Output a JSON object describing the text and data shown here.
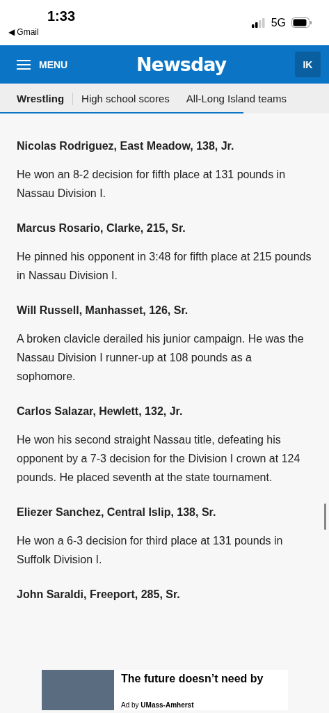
{
  "status_bar": {
    "time": "1:33",
    "back_app": "◀ Gmail",
    "network": "5G"
  },
  "header": {
    "menu_label": "MENU",
    "logo": "Newsday",
    "account_initials": "IK"
  },
  "tabs": [
    {
      "label": "Wrestling",
      "selected": true
    },
    {
      "label": "High school scores",
      "selected": false
    },
    {
      "label": "All-Long Island teams",
      "selected": false
    }
  ],
  "reading_progress": {
    "level": 0.74
  },
  "entries": [
    {
      "heading": "Nicolas Rodriguez, East Meadow, 138, Jr.",
      "text": "He won an 8-2 decision for fifth place at 131 pounds in Nassau Division I."
    },
    {
      "heading": "Marcus Rosario, Clarke, 215, Sr.",
      "text": "He pinned his opponent in 3:48 for fifth place at 215 pounds in Nassau Division I."
    },
    {
      "heading": "Will Russell, Manhasset, 126, Sr.",
      "text": "A broken clavicle derailed his junior campaign. He was the Nassau Division I runner-up at 108 pounds as a sophomore."
    },
    {
      "heading": "Carlos Salazar, Hewlett, 132, Jr.",
      "text": "He won his second straight Nassau title, defeating his opponent by a 7-3 decision for the Division I crown at 124 pounds. He placed seventh at the state tournament."
    },
    {
      "heading": "Eliezer Sanchez, Central Islip, 138, Sr.",
      "text": "He won a 6-3 decision for third place at 131 pounds in Suffolk Division I."
    },
    {
      "heading": "John Saraldi, Freeport, 285, Sr."
    }
  ],
  "ad": {
    "headline": "The future doesn’t need by",
    "label": "Ad by",
    "advertiser": "UMass-Amherst"
  }
}
